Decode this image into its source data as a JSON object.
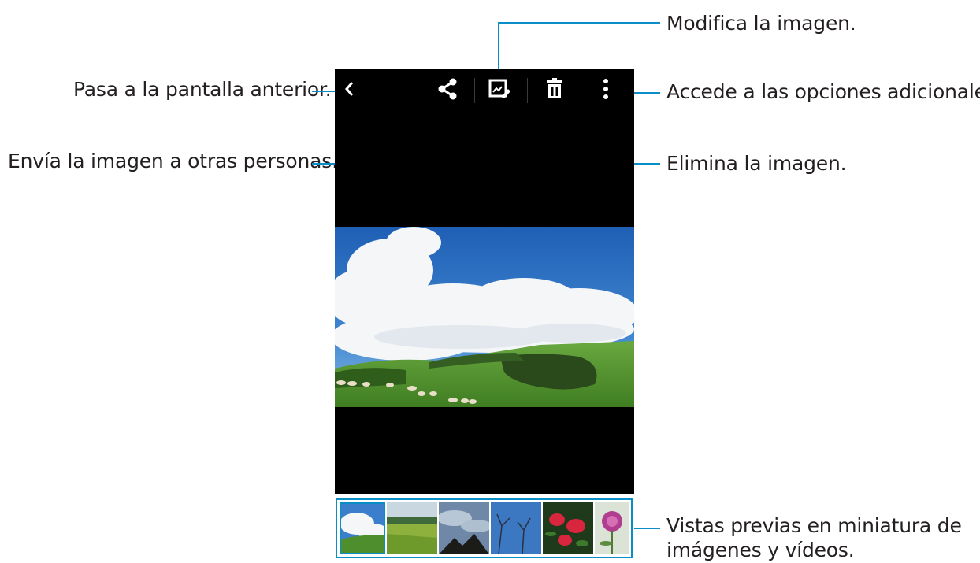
{
  "callouts": {
    "edit": "Modifica la imagen.",
    "back": "Pasa a la pantalla anterior.",
    "more": "Accede a las opciones adicionales.",
    "share": "Envía la imagen a otras personas.",
    "delete": "Elimina la imagen.",
    "thumbs_line1": "Vistas previas en miniatura de",
    "thumbs_line2": "imágenes y vídeos."
  },
  "toolbar": {
    "icons": [
      "back-arrow-icon",
      "share-icon",
      "edit-icon",
      "trash-icon",
      "more-options-icon"
    ]
  },
  "colors": {
    "callout_line": "#0a8ec8",
    "screen_bg": "#000000",
    "thumb_selected": "#0a8ec8"
  },
  "thumbnails": {
    "count": 6,
    "selected_index": 0
  }
}
